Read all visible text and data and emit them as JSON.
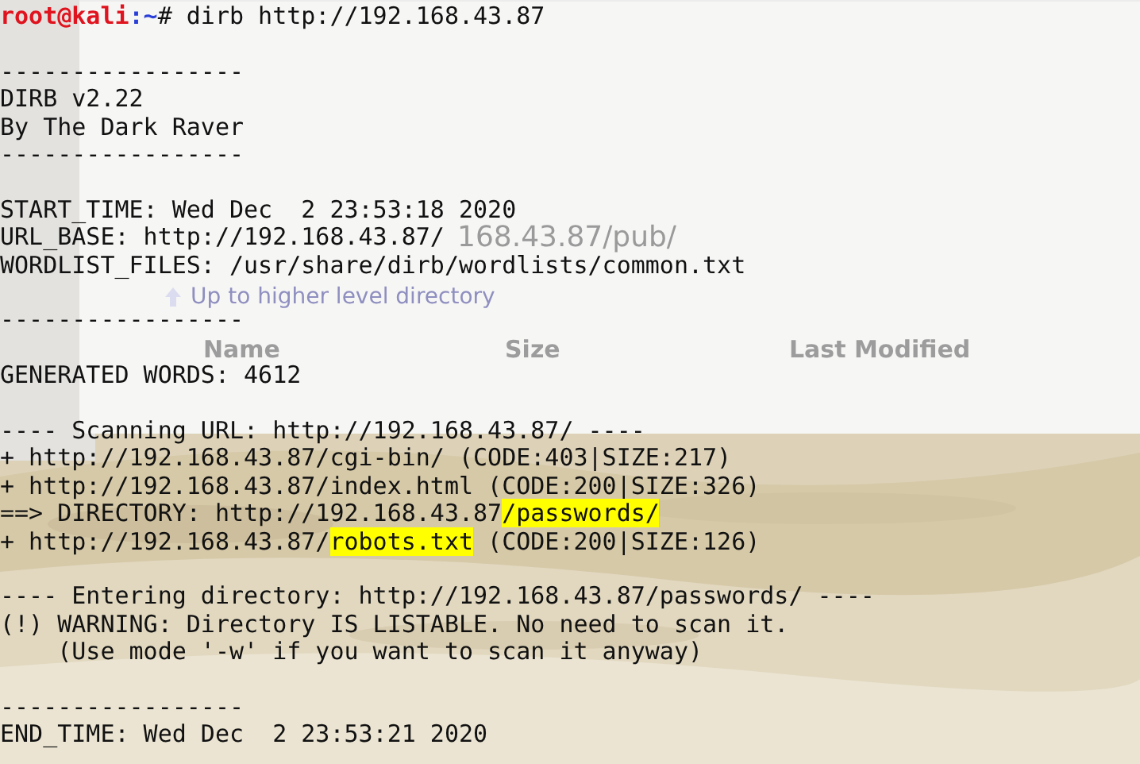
{
  "browser_page": {
    "heading": "168.43.87/pub/",
    "up_link": "Up to higher level directory",
    "columns": [
      "Name",
      "Size",
      "Last Modified"
    ]
  },
  "terminal": {
    "blocks": [
      [
        {
          "segments": [
            {
              "text": "root@kali",
              "kind": "user"
            },
            {
              "text": ":~",
              "kind": "path"
            },
            {
              "text": "# dirb http://192.168.43.87",
              "kind": "plain"
            }
          ]
        }
      ],
      [
        {
          "segments": [
            {
              "text": "-----------------",
              "kind": "plain"
            }
          ]
        },
        {
          "segments": [
            {
              "text": "DIRB v2.22",
              "kind": "plain"
            }
          ]
        },
        {
          "segments": [
            {
              "text": "By The Dark Raver",
              "kind": "plain"
            }
          ]
        },
        {
          "segments": [
            {
              "text": "-----------------",
              "kind": "plain"
            }
          ]
        }
      ],
      [
        {
          "segments": [
            {
              "text": "START_TIME: Wed Dec  2 23:53:18 2020",
              "kind": "plain"
            }
          ]
        },
        {
          "segments": [
            {
              "text": "URL_BASE: http://192.168.43.87/",
              "kind": "plain"
            }
          ]
        },
        {
          "segments": [
            {
              "text": "WORDLIST_FILES: /usr/share/dirb/wordlists/common.txt",
              "kind": "plain"
            }
          ]
        }
      ],
      [
        {
          "segments": [
            {
              "text": "-----------------",
              "kind": "plain"
            }
          ]
        }
      ],
      [
        {
          "segments": [
            {
              "text": "GENERATED WORDS: 4612",
              "kind": "plain"
            }
          ]
        }
      ],
      [
        {
          "segments": [
            {
              "text": "---- Scanning URL: http://192.168.43.87/ ----",
              "kind": "plain"
            }
          ]
        },
        {
          "segments": [
            {
              "text": "+ http://192.168.43.87/cgi-bin/ (CODE:403|SIZE:217)",
              "kind": "plain"
            }
          ]
        },
        {
          "segments": [
            {
              "text": "+ http://192.168.43.87/index.html (CODE:200|SIZE:326)",
              "kind": "plain"
            }
          ]
        },
        {
          "segments": [
            {
              "text": "==> DIRECTORY: http://192.168.43.87",
              "kind": "plain"
            },
            {
              "text": "/passwords/",
              "kind": "highlight"
            }
          ]
        },
        {
          "segments": [
            {
              "text": "+ http://192.168.43.87/",
              "kind": "plain"
            },
            {
              "text": "robots.txt",
              "kind": "highlight"
            },
            {
              "text": " (CODE:200|SIZE:126)",
              "kind": "plain"
            }
          ]
        }
      ],
      [
        {
          "segments": [
            {
              "text": "---- Entering directory: http://192.168.43.87/passwords/ ----",
              "kind": "plain"
            }
          ]
        },
        {
          "segments": [
            {
              "text": "(!) WARNING: Directory IS LISTABLE. No need to scan it.",
              "kind": "plain"
            }
          ]
        },
        {
          "segments": [
            {
              "text": "    (Use mode '-w' if you want to scan it anyway)",
              "kind": "plain"
            }
          ]
        }
      ],
      [
        {
          "segments": [
            {
              "text": "-----------------",
              "kind": "plain"
            }
          ]
        },
        {
          "segments": [
            {
              "text": "END_TIME: Wed Dec  2 23:53:21 2020",
              "kind": "plain"
            }
          ]
        }
      ]
    ]
  }
}
